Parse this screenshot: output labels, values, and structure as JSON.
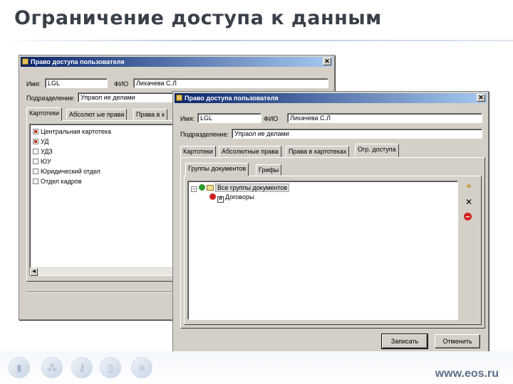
{
  "slide": {
    "title": "Ограничение доступа к данным",
    "footer_url": "www.eos.ru"
  },
  "back_window": {
    "title": "Право доступа пользователя",
    "name_label": "Имя:",
    "name_value": "LGL",
    "fio_label": "ФИО",
    "fio_value": "Лихачева С.Л",
    "dept_label": "Подразделение:",
    "dept_value": "Упраол ие делами",
    "tabs": [
      "Картотеки",
      "Абсолют ые права",
      "Права в к"
    ],
    "list_items": [
      {
        "label": "Центральная картотека",
        "checked": true
      },
      {
        "label": "УД",
        "checked": true
      },
      {
        "label": "УДЗ",
        "checked": false
      },
      {
        "label": "ЮУ",
        "checked": false
      },
      {
        "label": "Юридический отдел",
        "checked": false
      },
      {
        "label": "Отдел кадров",
        "checked": false
      }
    ]
  },
  "front_window": {
    "title": "Право доступа пользователя",
    "name_label": "Имя:",
    "name_value": "LGL",
    "fio_label": "ФИО",
    "fio_value": "Лихачева С.Л",
    "dept_label": "Подразделение:",
    "dept_value": "Упраол ие делами",
    "tabs": [
      "Картотеки",
      "Абсолютные права",
      "Права в картотеках",
      "Огр. доступа"
    ],
    "subtabs": [
      "Группы документов",
      "Грифы"
    ],
    "tree": {
      "root_label": "Все группы документов",
      "child_label": "Договоры",
      "child_doc_letter": "И"
    },
    "side_icons": [
      "add-icon",
      "delete-icon",
      "remove-icon"
    ],
    "side_glyphs": [
      "✶",
      "✕",
      "–"
    ],
    "buttons": {
      "save": "Записать",
      "cancel": "Отменить"
    }
  },
  "footer_icons": [
    "book-icon",
    "tree-icon",
    "key-icon",
    "document-icon",
    "clipboard-icon"
  ],
  "colors": {
    "title_text": "#3a3f48",
    "titlebar_start": "#0a246a",
    "titlebar_end": "#a6caf0",
    "window_face": "#d4d0c8",
    "footer_text": "#5d6e8a"
  }
}
